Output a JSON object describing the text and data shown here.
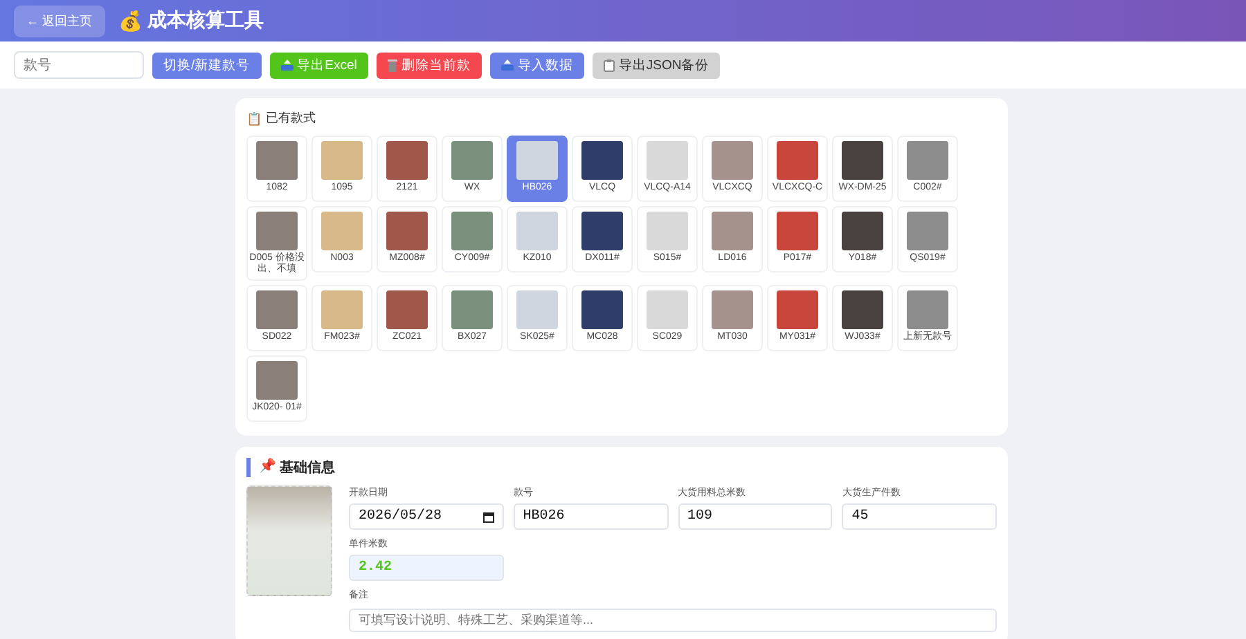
{
  "header": {
    "back_button": "← 返回主页",
    "title_icon": "💰",
    "title": "成本核算工具"
  },
  "toolbar": {
    "style_no_field": {
      "placeholder": "款号"
    },
    "buttons": [
      {
        "label": "切换/新建款号",
        "kind": "switch"
      },
      {
        "label": "导出Excel",
        "kind": "export"
      },
      {
        "label": "删除当前款",
        "kind": "delete"
      },
      {
        "label": "导入数据",
        "kind": "import"
      },
      {
        "label": "导出JSON备份",
        "kind": "backup"
      }
    ]
  },
  "styles_panel": {
    "icon": "📋",
    "title": "已有款式",
    "styles": [
      {
        "label": "1082",
        "selected": false
      },
      {
        "label": "1095",
        "selected": false
      },
      {
        "label": "2121",
        "selected": false
      },
      {
        "label": "WX",
        "selected": false
      },
      {
        "label": "HB026",
        "selected": true
      },
      {
        "label": "VLCQ",
        "selected": false
      },
      {
        "label": "VLCQ-A14",
        "selected": false
      },
      {
        "label": "VLCXCQ",
        "selected": false
      },
      {
        "label": "VLCXCQ-C",
        "selected": false
      },
      {
        "label": "WX-DM-25",
        "selected": false
      },
      {
        "label": "C002#",
        "selected": false
      },
      {
        "label": "D005 价格没出、不填",
        "selected": false
      },
      {
        "label": "N003",
        "selected": false
      },
      {
        "label": "MZ008#",
        "selected": false
      },
      {
        "label": "CY009#",
        "selected": false
      },
      {
        "label": "KZ010",
        "selected": false
      },
      {
        "label": "DX011#",
        "selected": false
      },
      {
        "label": "S015#",
        "selected": false
      },
      {
        "label": "LD016",
        "selected": false
      },
      {
        "label": "P017#",
        "selected": false
      },
      {
        "label": "Y018#",
        "selected": false
      },
      {
        "label": "QS019#",
        "selected": false
      },
      {
        "label": "SD022",
        "selected": false
      },
      {
        "label": "FM023#",
        "selected": false
      },
      {
        "label": "ZC021",
        "selected": false
      },
      {
        "label": "BX027",
        "selected": false
      },
      {
        "label": "SK025#",
        "selected": false
      },
      {
        "label": "MC028",
        "selected": false
      },
      {
        "label": "SC029",
        "selected": false
      },
      {
        "label": "MT030",
        "selected": false
      },
      {
        "label": "MY031#",
        "selected": false
      },
      {
        "label": "WJ033#",
        "selected": false
      },
      {
        "label": "上新无款号",
        "selected": false
      },
      {
        "label": "JK020- 01#",
        "selected": false
      }
    ]
  },
  "basic_info": {
    "icon": "📌",
    "title": "基础信息",
    "fields": [
      {
        "label": "开款日期",
        "value": "2026/05/28",
        "kind": "date"
      },
      {
        "label": "款号",
        "value": "HB026",
        "kind": "text"
      },
      {
        "label": "大货用料总米数",
        "value": "109",
        "kind": "text"
      },
      {
        "label": "大货生产件数",
        "value": "45",
        "kind": "text"
      },
      {
        "label": "单件米数",
        "value": "2.42",
        "kind": "computed"
      }
    ],
    "note": {
      "label": "备注",
      "placeholder": "可填写设计说明、特殊工艺、采购渠道等..."
    }
  }
}
